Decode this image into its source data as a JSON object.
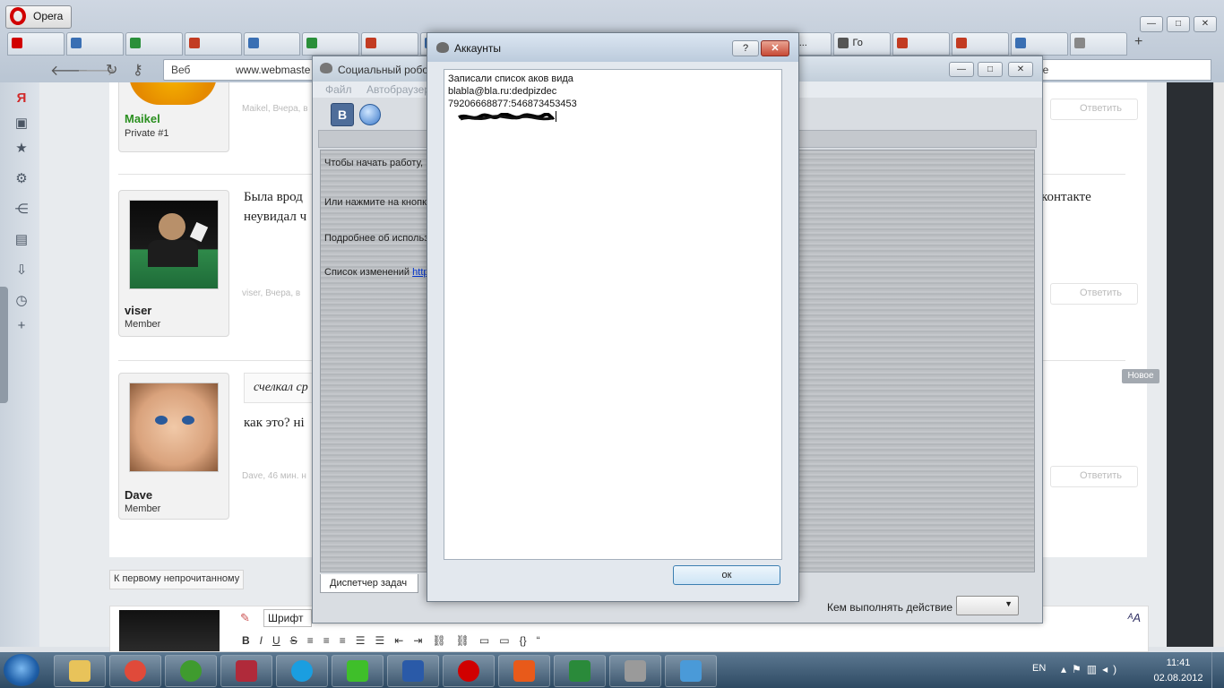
{
  "browser": {
    "app_name": "Opera",
    "address_prefix": "Веб",
    "address_url": "www.webmaste",
    "address_right": "le",
    "tabs": [
      {
        "label": "",
        "color": "#d10000"
      },
      {
        "label": "",
        "color": "#3a6fb3"
      },
      {
        "label": "",
        "color": "#2a8f3a"
      },
      {
        "label": "",
        "color": "#c23b22"
      },
      {
        "label": "",
        "color": "#3a6fb3"
      },
      {
        "label": "",
        "color": "#2a8f3a"
      },
      {
        "label": "",
        "color": "#c23b22"
      },
      {
        "label": "",
        "color": "#3a6fb3"
      },
      {
        "label": "",
        "color": "#2a8f3a"
      },
      {
        "label": "",
        "color": "#3a6fb3"
      },
      {
        "label": "",
        "color": "#c23b22"
      },
      {
        "label": "",
        "color": "#3a6fb3"
      },
      {
        "label": "",
        "color": "#2a8f3a"
      },
      {
        "label": "р...",
        "color": "#34a853"
      },
      {
        "label": "Го",
        "color": "#555555"
      },
      {
        "label": "",
        "color": "#c23b22"
      },
      {
        "label": "",
        "color": "#c23b22"
      },
      {
        "label": "",
        "color": "#3a6fb3"
      },
      {
        "label": "",
        "color": "#888888"
      }
    ]
  },
  "forum": {
    "posts": [
      {
        "username": "Maikel",
        "role": "Private #1",
        "meta": "Maikel, Вчера, в",
        "reply": "Ответить",
        "name_color": "#2a8f1f"
      },
      {
        "username": "viser",
        "role": "Member",
        "meta": "viser, Вчера, в",
        "reply": "Ответить",
        "text1": "Была врод",
        "text2": "неувидал ч",
        "text_right": "контакте"
      },
      {
        "username": "Dave",
        "role": "Member",
        "meta": "Dave, 46 мин. н",
        "reply": "Ответить",
        "quote": "счелкал ср",
        "text1": "как это? нi"
      }
    ],
    "new_badge": "Новое",
    "first_unread_button": "К первому непрочитанному",
    "editor": {
      "font_label": "Шрифт",
      "format_buttons": [
        "B",
        "I",
        "U",
        "S"
      ]
    }
  },
  "robot_window": {
    "title": "Социальный робо",
    "menu": [
      "Файл",
      "Автобраузер"
    ],
    "toolbar_vk_label": "В",
    "lines": [
      "Чтобы начать работу,",
      "Или нажмите на кнопк",
      "Подробнее об использ",
      "Список изменений"
    ],
    "link_text": "http",
    "task_tab": "Диспетчер задач",
    "action_label": "Кем выполнять действие"
  },
  "accounts_dialog": {
    "title": "Аккаунты",
    "help_label": "?",
    "lines": [
      "Записали список аков вида",
      "blabla@bla.ru:dedpizdec",
      "79206668877:546873453453"
    ],
    "ok_label": "ок"
  },
  "taskbar": {
    "language": "EN",
    "time": "11:41",
    "date": "02.08.2012",
    "apps": [
      {
        "name": "explorer",
        "color": "#e8c35a"
      },
      {
        "name": "chrome",
        "color": "#e04a3a"
      },
      {
        "name": "utorrent",
        "color": "#3f9b2e"
      },
      {
        "name": "disk-tool",
        "color": "#b02a3a"
      },
      {
        "name": "skype",
        "color": "#1a9ee0"
      },
      {
        "name": "icq",
        "color": "#3fbf2a"
      },
      {
        "name": "word",
        "color": "#2a5aa8"
      },
      {
        "name": "opera",
        "color": "#d10000"
      },
      {
        "name": "download-master",
        "color": "#e85a1a"
      },
      {
        "name": "excel",
        "color": "#2a8a3a"
      },
      {
        "name": "robot",
        "color": "#9a9a9a"
      },
      {
        "name": "paint",
        "color": "#4a9ad8"
      }
    ]
  }
}
